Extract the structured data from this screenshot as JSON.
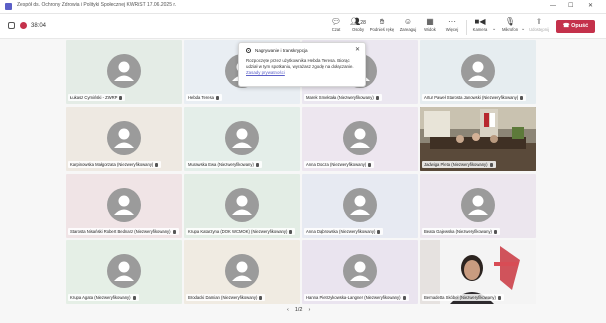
{
  "window": {
    "title": "Zespół ds. Ochrony Zdrowia i Polityki Społecznej KWRiST 17.06.2025 r.",
    "min": "—",
    "max": "☐",
    "close": "✕"
  },
  "toolbar": {
    "timer": "38:04",
    "chat_label": "Czat",
    "people_label": "Osoby",
    "people_count": "28",
    "raise_label": "Podnieś rękę",
    "react_label": "Zareaguj",
    "view_label": "Widok",
    "more_label": "Więcej",
    "camera_label": "Kamera",
    "mic_label": "Mikrofon",
    "share_label": "Udostępnij",
    "leave_label": "Opuść",
    "colors": {
      "leave": "#c4314b",
      "brand": "#5b5fc7"
    }
  },
  "popup": {
    "title": "Nagrywanie i transkrypcja",
    "body": "Rozpoczęte przez użytkownika Hebda Teresa. Biorąc udział w tym spotkaniu, wyrażasz zgodę na dołączanie.",
    "link": "Zasady prywatności",
    "close": "✕"
  },
  "participants": [
    {
      "name": "Łukasz Cymiński - ZWRP",
      "bg": "#e4ece6"
    },
    {
      "name": "Hebda Teresa",
      "bg": "#e9eef3"
    },
    {
      "name": "Marek Smektała (Niezweryfikowany)",
      "bg": "#ebe7f0"
    },
    {
      "name": "Artur Paweł Starosta Janowski (Niezweryfikowany)",
      "bg": "#e6edf0"
    },
    {
      "name": "Karpinowska Małgorzata (Niezweryfikowany)",
      "bg": "#eee9e2"
    },
    {
      "name": "Murawska Ewa (Niezweryfikowany)",
      "bg": "#e4eee9"
    },
    {
      "name": "Anna Docza (Niezweryfikowany)",
      "bg": "#ede6ef"
    },
    {
      "name": "Jadwiga Pleta (Niezweryfikowany)",
      "bg": "#6f6a5e",
      "photo": true
    },
    {
      "name": "Starosta Nisański Robert Bednarz (Niezweryfikowany)",
      "bg": "#f0e4e6"
    },
    {
      "name": "Krupa Katarzyna (DOK WCMOK) (Niezweryfikowany)",
      "bg": "#e3ede5"
    },
    {
      "name": "Anna Dąbrowska (Niezweryfikowany)",
      "bg": "#e7eaf2"
    },
    {
      "name": "Beata Gajewska (Niezweryfikowany)",
      "bg": "#ece6ee"
    },
    {
      "name": "Krupa Agata (Niezweryfikowany)",
      "bg": "#e5efe6"
    },
    {
      "name": "Brodacki Damian (Niezweryfikowany)",
      "bg": "#f0ebe2"
    },
    {
      "name": "Hanna Pietrzykowska-Langner (Niezweryfikowany)",
      "bg": "#eae4ef"
    },
    {
      "name": "Bernadetta Skóbel (Niezweryfikowany)",
      "bg": "#f2f2f2",
      "photo": true
    }
  ],
  "pager": {
    "prev": "‹",
    "label": "1/2",
    "next": "›"
  },
  "icons": [
    "chat-icon",
    "people-icon",
    "raise-hand-icon",
    "react-icon",
    "view-icon",
    "more-icon",
    "camera-icon",
    "mic-icon",
    "share-icon",
    "phone-icon",
    "record-icon",
    "shield-icon"
  ]
}
